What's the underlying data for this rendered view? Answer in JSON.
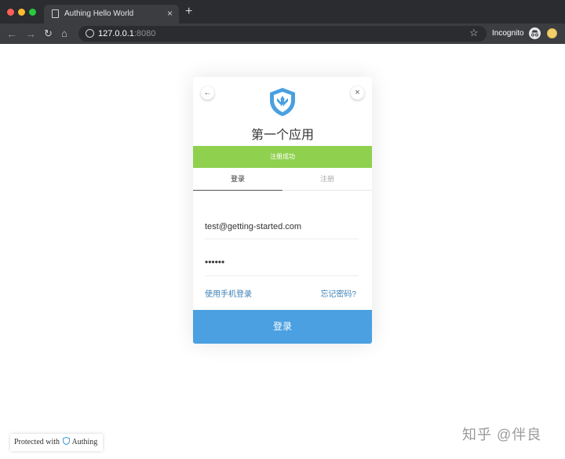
{
  "browser": {
    "tab_title": "Authing Hello World",
    "tab_close": "×",
    "new_tab": "+",
    "url_host": "127.0.0.1",
    "url_port": ":8080",
    "incognito_label": "Incognito",
    "icons": {
      "back": "arrow-left-icon",
      "forward": "arrow-right-icon",
      "reload": "reload-icon",
      "home": "home-icon",
      "info": "info-icon",
      "bookmark": "star-icon"
    }
  },
  "card": {
    "title": "第一个应用",
    "success_message": "注册成功",
    "tabs": [
      {
        "label": "登录",
        "active": true
      },
      {
        "label": "注册",
        "active": false
      }
    ],
    "email_value": "test@getting-started.com",
    "password_value": "••••••",
    "phone_login_link": "使用手机登录",
    "forgot_password_link": "忘记密码?",
    "submit_label": "登录",
    "back_glyph": "←",
    "close_glyph": "×"
  },
  "footer": {
    "protected_prefix": "Protected with",
    "protected_brand": "Authing",
    "watermark": "知乎 @伴良"
  },
  "colors": {
    "success": "#8fd14f",
    "primary": "#4aa0e0",
    "link": "#3d7fb4",
    "logo": "#4aa0e0"
  }
}
